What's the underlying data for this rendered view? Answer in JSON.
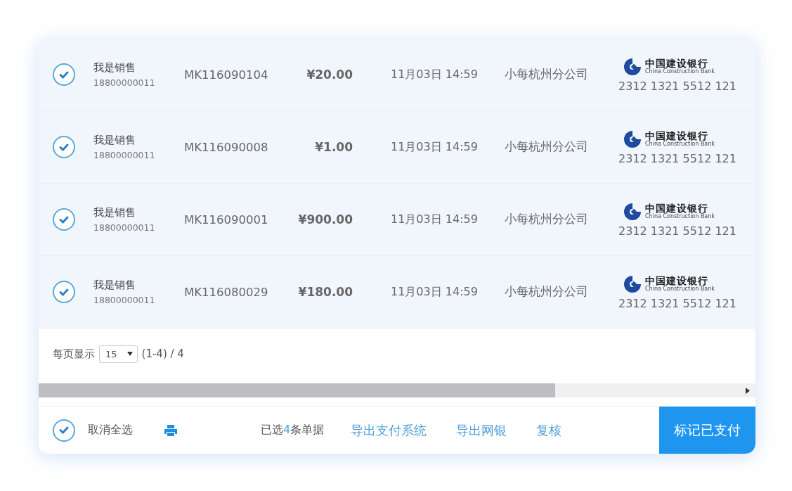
{
  "rows": [
    {
      "checked": true,
      "name": "我是销售",
      "phone": "18800000011",
      "order": "MK116090104",
      "amount": "¥20.00",
      "time": "11月03日 14:59",
      "branch": "小每杭州分公司",
      "bank_name": "中国建设银行",
      "bank_english": "China Construction Bank",
      "account": "2312 1321 5512 121"
    },
    {
      "checked": true,
      "name": "我是销售",
      "phone": "18800000011",
      "order": "MK116090008",
      "amount": "¥1.00",
      "time": "11月03日 14:59",
      "branch": "小每杭州分公司",
      "bank_name": "中国建设银行",
      "bank_english": "China Construction Bank",
      "account": "2312 1321 5512 121"
    },
    {
      "checked": true,
      "name": "我是销售",
      "phone": "18800000011",
      "order": "MK116090001",
      "amount": "¥900.00",
      "time": "11月03日 14:59",
      "branch": "小每杭州分公司",
      "bank_name": "中国建设银行",
      "bank_english": "China Construction Bank",
      "account": "2312 1321 5512 121"
    },
    {
      "checked": true,
      "name": "我是销售",
      "phone": "18800000011",
      "order": "MK116080029",
      "amount": "¥180.00",
      "time": "11月03日 14:59",
      "branch": "小每杭州分公司",
      "bank_name": "中国建设银行",
      "bank_english": "China Construction Bank",
      "account": "2312 1321 5512 121"
    }
  ],
  "pagination": {
    "label": "每页显示",
    "page_size": "15",
    "range": "(1-4) / 4"
  },
  "footer": {
    "select_all": {
      "checked": true,
      "label": "取消全选"
    },
    "selected_count": {
      "prefix": "已选",
      "count": "4",
      "suffix": "条单据"
    },
    "links": [
      "导出支付系统",
      "导出网银",
      "复核"
    ],
    "primary_button": "标记已支付"
  }
}
